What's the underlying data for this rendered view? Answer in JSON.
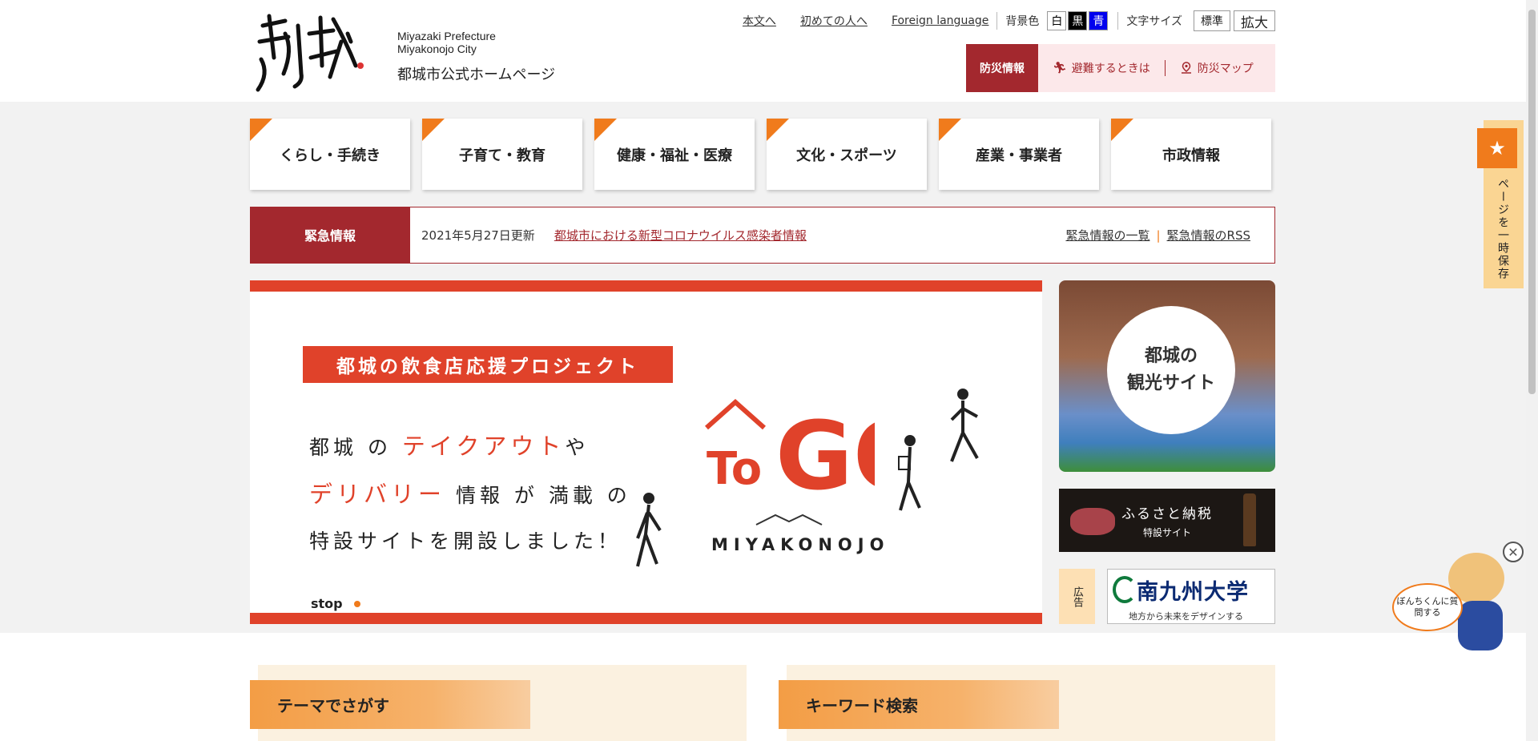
{
  "header": {
    "logo_mark_alt": "都城",
    "logo_en_line1": "Miyazaki Prefecture",
    "logo_en_line2": "Miyakonojo City",
    "logo_jp": "都城市公式ホームページ",
    "links": [
      "本文へ",
      "初めての人へ",
      "Foreign language"
    ],
    "bg_color_label": "背景色",
    "bg_colors": [
      {
        "label": "白",
        "bg": "#ffffff",
        "fg": "#000000"
      },
      {
        "label": "黒",
        "bg": "#000000",
        "fg": "#ffffff"
      },
      {
        "label": "青",
        "bg": "#0000ee",
        "fg": "#ffffff"
      }
    ],
    "font_size_label": "文字サイズ",
    "font_size_standard": "標準",
    "font_size_large": "拡大",
    "disaster": {
      "title": "防災情報",
      "evacuation": "避難するときは",
      "map": "防災マップ"
    }
  },
  "nav": [
    "くらし・手続き",
    "子育て・教育",
    "健康・福祉・医療",
    "文化・スポーツ",
    "産業・事業者",
    "市政情報"
  ],
  "alert": {
    "title": "緊急情報",
    "date": "2021年5月27日更新",
    "link": "都城市における新型コロナウイルス感染者情報",
    "list_link": "緊急情報の一覧",
    "rss_link": "緊急情報のRSS"
  },
  "banner": {
    "title": "都城の飲食店応援プロジェクト",
    "line1_a": "都城 の ",
    "line1_red": "テイクアウト",
    "line1_b": "や",
    "line2_red": "デリバリー",
    "line2_b": " 情報 が 満載 の",
    "line3": "特設サイトを開設しました！",
    "logo_to": "To",
    "logo_go": "GO",
    "logo_sub": "MIYAKONOJO",
    "stop_label": "stop"
  },
  "sidebar": {
    "tourism_line1": "都城の",
    "tourism_line2": "観光サイト",
    "furusato_title": "ふるさと納税",
    "furusato_sub": "特設サイト",
    "ad_label": "広告",
    "ad_title": "南九州大学",
    "ad_sub": "地方から未来をデザインする"
  },
  "sections": {
    "theme": "テーマでさがす",
    "keyword": "キーワード検索"
  },
  "widgets": {
    "save_text": "ページを一時保存",
    "mascot_bubble": "ぼんちくんに質問する"
  },
  "colors": {
    "accent_orange": "#f07b1c",
    "alert_red": "#a3282e",
    "banner_red": "#e0422a"
  }
}
